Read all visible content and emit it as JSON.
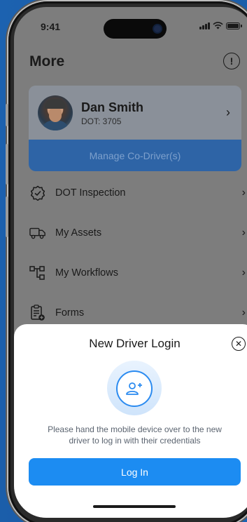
{
  "status": {
    "time": "9:41"
  },
  "header": {
    "title": "More",
    "info_icon": "info-icon"
  },
  "profile": {
    "name": "Dan Smith",
    "dot": "DOT: 3705",
    "manage_label": "Manage Co-Driver(s)"
  },
  "menu": {
    "items": [
      {
        "label": "DOT Inspection",
        "icon": "badge-check-icon"
      },
      {
        "label": "My Assets",
        "icon": "truck-icon"
      },
      {
        "label": "My Workflows",
        "icon": "workflow-icon"
      },
      {
        "label": "Forms",
        "icon": "form-add-icon"
      }
    ]
  },
  "sheet": {
    "title": "New Driver Login",
    "message": "Please hand the mobile device over to the new driver to log in with their credentials",
    "login_label": "Log In"
  },
  "colors": {
    "background": "#1a5da8",
    "primary": "#1c8cf2",
    "overlay_button": "#2e64a6"
  }
}
